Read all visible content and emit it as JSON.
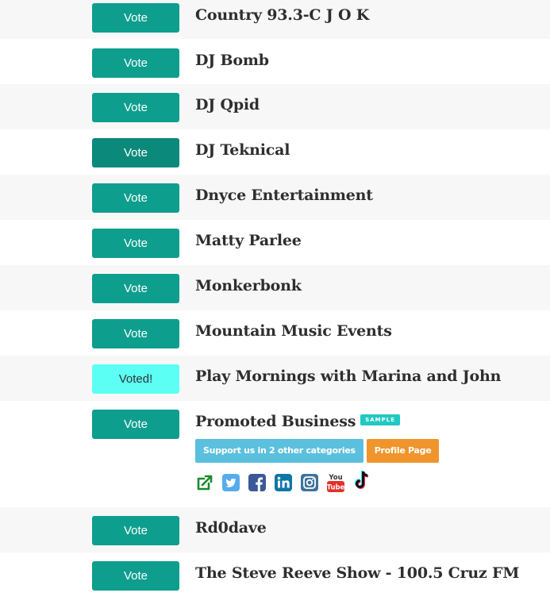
{
  "entries": [
    {
      "name": "Country 93.3-C J O K",
      "button": "Vote"
    },
    {
      "name": "DJ Bomb",
      "button": "Vote"
    },
    {
      "name": "DJ Qpid",
      "button": "Vote"
    },
    {
      "name": "DJ Teknical",
      "button": "Vote"
    },
    {
      "name": "Dnyce Entertainment",
      "button": "Vote"
    },
    {
      "name": "Matty Parlee",
      "button": "Vote"
    },
    {
      "name": "Monkerbonk",
      "button": "Vote"
    },
    {
      "name": "Mountain Music Events",
      "button": "Vote"
    },
    {
      "name": "Play Mornings with Marina and John",
      "button": "Voted!"
    },
    {
      "name": "Promoted Business",
      "button": "Vote"
    },
    {
      "name": "Rd0dave",
      "button": "Vote"
    },
    {
      "name": "The Steve Reeve Show - 100.5 Cruz FM",
      "button": "Vote"
    }
  ],
  "promoted": {
    "badge": "SAMPLE",
    "support_label": "Support us in 2 other categories",
    "profile_label": "Profile Page",
    "social_icons": [
      "external-link-icon",
      "twitter-icon",
      "facebook-icon",
      "linkedin-icon",
      "instagram-icon",
      "youtube-icon",
      "tiktok-icon"
    ],
    "youtube_top": "You",
    "youtube_bottom": "Tube"
  },
  "colors": {
    "vote_button": "#0e9e8e",
    "voted_button": "#5cfff4",
    "support_button": "#5bc0de",
    "profile_button": "#f0952b",
    "badge": "#20c9c1"
  }
}
